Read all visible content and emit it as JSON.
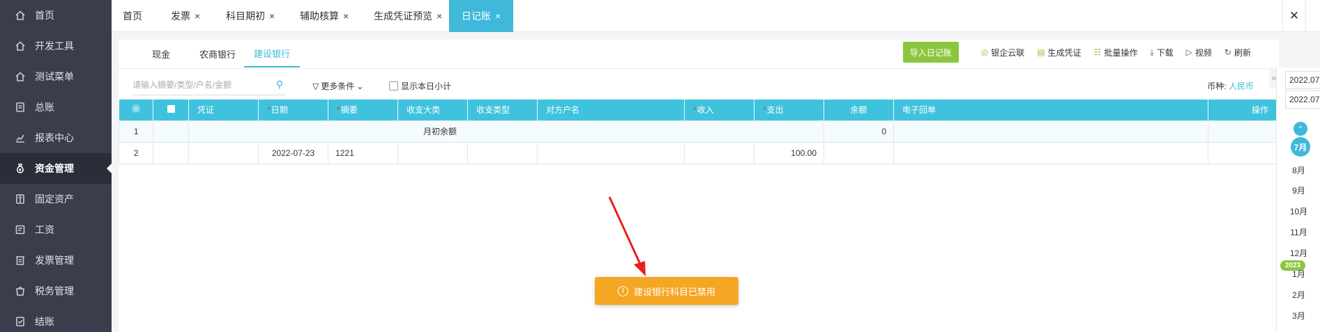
{
  "sidebar": {
    "items": [
      {
        "label": "首页",
        "icon": "home-icon"
      },
      {
        "label": "开发工具",
        "icon": "home-icon"
      },
      {
        "label": "测试菜单",
        "icon": "home-icon"
      },
      {
        "label": "总账",
        "icon": "ledger-icon"
      },
      {
        "label": "报表中心",
        "icon": "chart-icon"
      },
      {
        "label": "资金管理",
        "icon": "money-bag-icon"
      },
      {
        "label": "固定资产",
        "icon": "asset-icon"
      },
      {
        "label": "工资",
        "icon": "salary-icon"
      },
      {
        "label": "发票管理",
        "icon": "invoice-icon"
      },
      {
        "label": "税务管理",
        "icon": "tax-icon"
      },
      {
        "label": "结账",
        "icon": "close-books-icon"
      }
    ]
  },
  "tabs": [
    {
      "label": "首页",
      "closable": false
    },
    {
      "label": "发票",
      "closable": true
    },
    {
      "label": "科目期初",
      "closable": true
    },
    {
      "label": "辅助核算",
      "closable": true
    },
    {
      "label": "生成凭证预览",
      "closable": true
    },
    {
      "label": "日记账",
      "closable": true
    }
  ],
  "tab_close_symbol": "×",
  "window_close_symbol": "✕",
  "subtabs": [
    "现金",
    "农商银行",
    "建设银行"
  ],
  "toolbar": {
    "import_label": "导入日记账",
    "bank_label": "银企云联",
    "voucher_label": "生成凭证",
    "batch_label": "批量操作",
    "download_label": "下载",
    "video_label": "视频",
    "refresh_label": "刷新"
  },
  "filter": {
    "search_placeholder": "请输入摘要/类型/户名/金额",
    "more_label": "更多条件",
    "subtotal_label": "显示本日小计",
    "currency_label": "币种:",
    "currency_value": "人民币"
  },
  "table": {
    "headers": {
      "voucher": "凭证",
      "date": "日期",
      "summary": "摘要",
      "category": "收支大类",
      "type": "收支类型",
      "account_name": "对方户名",
      "income": "收入",
      "expense": "支出",
      "balance": "余额",
      "receipt": "电子回单",
      "action": "操作"
    },
    "rows": [
      {
        "index": "1",
        "summary": "月初余额",
        "balance": "0"
      },
      {
        "index": "2",
        "date": "2022-07-23",
        "summary": "1221",
        "expense": "100.00"
      }
    ]
  },
  "toast": {
    "message": "建设银行科目已禁用"
  },
  "right_panel": {
    "date_start": "2022.07",
    "date_end": "2022.07",
    "expander": "»",
    "months_2022": [
      "7月",
      "8月",
      "9月",
      "10月",
      "11月",
      "12月"
    ],
    "year_badge": "2023",
    "months_2023": [
      "1月",
      "2月",
      "3月"
    ]
  },
  "colors": {
    "sidebar_bg": "#3a3d4c",
    "accent": "#3fb8da",
    "table_header": "#3fc2dd",
    "import_button": "#8cc63e",
    "toast": "#f5a623"
  }
}
